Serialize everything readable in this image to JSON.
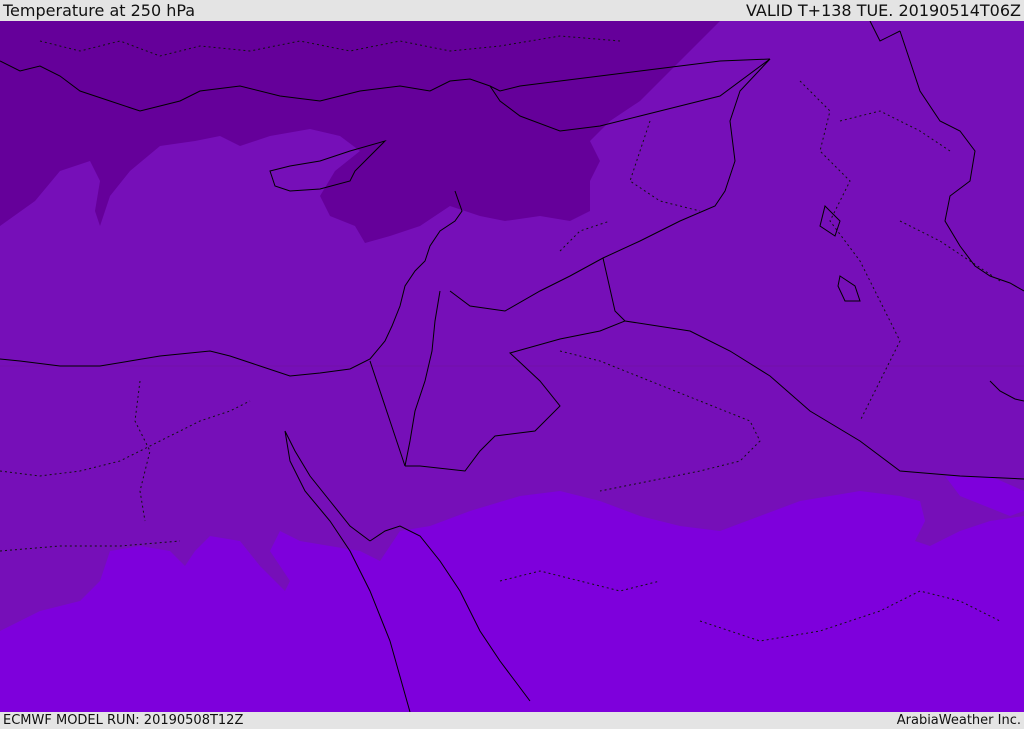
{
  "header": {
    "title": "Temperature at 250 hPa",
    "valid": "VALID T+138 TUE. 20190514T06Z"
  },
  "footer": {
    "model_run": "ECMWF MODEL RUN: 20190508T12Z",
    "credit": "ArabiaWeather Inc."
  },
  "map": {
    "field": "temperature-250hPa",
    "colors": {
      "darkest": "#65009a",
      "mid": "#760fb8",
      "band": "#7410b0",
      "bright": "#7e00dc"
    }
  }
}
